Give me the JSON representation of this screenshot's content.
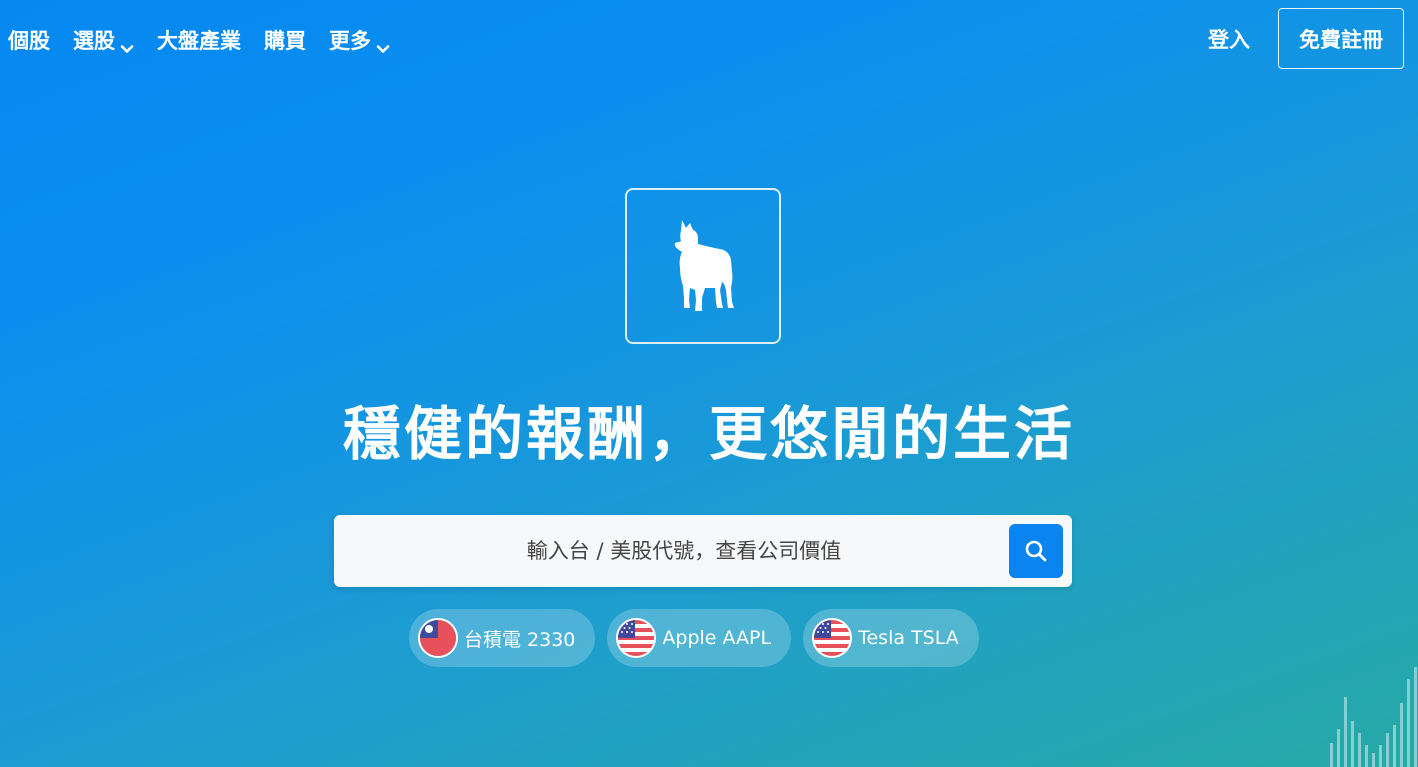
{
  "nav": {
    "left": [
      {
        "label": "個股",
        "has_dropdown": false
      },
      {
        "label": "選股",
        "has_dropdown": true
      },
      {
        "label": "大盤產業",
        "has_dropdown": false
      },
      {
        "label": "購買",
        "has_dropdown": false
      },
      {
        "label": "更多",
        "has_dropdown": true
      }
    ],
    "login_label": "登入",
    "signup_label": "免費註冊"
  },
  "hero": {
    "logo_icon": "dog-icon",
    "headline": "穩健的報酬，更悠閒的生活"
  },
  "search": {
    "placeholder": "輸入台 / 美股代號，查看公司價值",
    "button_icon": "search-icon"
  },
  "quick_links": [
    {
      "flag": "taiwan-flag-icon",
      "label": "台積電 2330"
    },
    {
      "flag": "us-flag-icon",
      "label": "Apple AAPL"
    },
    {
      "flag": "us-flag-icon",
      "label": "Tesla TSLA"
    }
  ],
  "colors": {
    "accent": "#0a84f0",
    "background_start": "#0588f0",
    "background_end": "#27a9a6"
  }
}
